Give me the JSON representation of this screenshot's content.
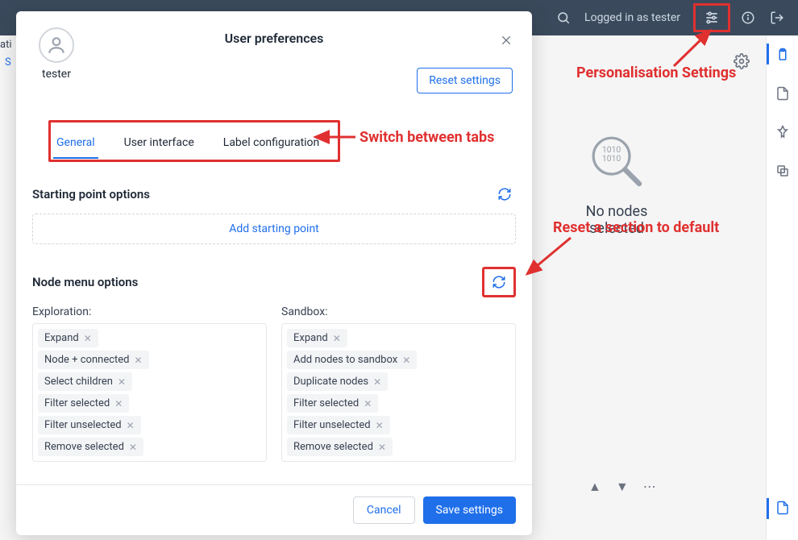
{
  "topbar": {
    "login_text": "Logged in as tester"
  },
  "annotations": {
    "personalisation": "Personalisation Settings",
    "switch_tabs": "Switch between tabs",
    "reset_section": "Reset a section to default"
  },
  "behind": {
    "no_nodes": "No nodes selected"
  },
  "modal": {
    "title": "User preferences",
    "username": "tester",
    "reset_settings": "Reset settings",
    "tabs": {
      "general": "General",
      "ui": "User interface",
      "label": "Label configuration"
    },
    "section_starting": "Starting point options",
    "add_starting": "Add starting point",
    "section_node_menu": "Node menu options",
    "exploration_label": "Exploration:",
    "sandbox_label": "Sandbox:",
    "exploration_items": [
      "Expand",
      "Node + connected",
      "Select children",
      "Filter selected",
      "Filter unselected",
      "Remove selected"
    ],
    "sandbox_items": [
      "Expand",
      "Add nodes to sandbox",
      "Duplicate nodes",
      "Filter selected",
      "Filter unselected",
      "Remove selected"
    ],
    "cancel": "Cancel",
    "save": "Save settings"
  },
  "edge": {
    "ati": "ati",
    "s": "S"
  }
}
